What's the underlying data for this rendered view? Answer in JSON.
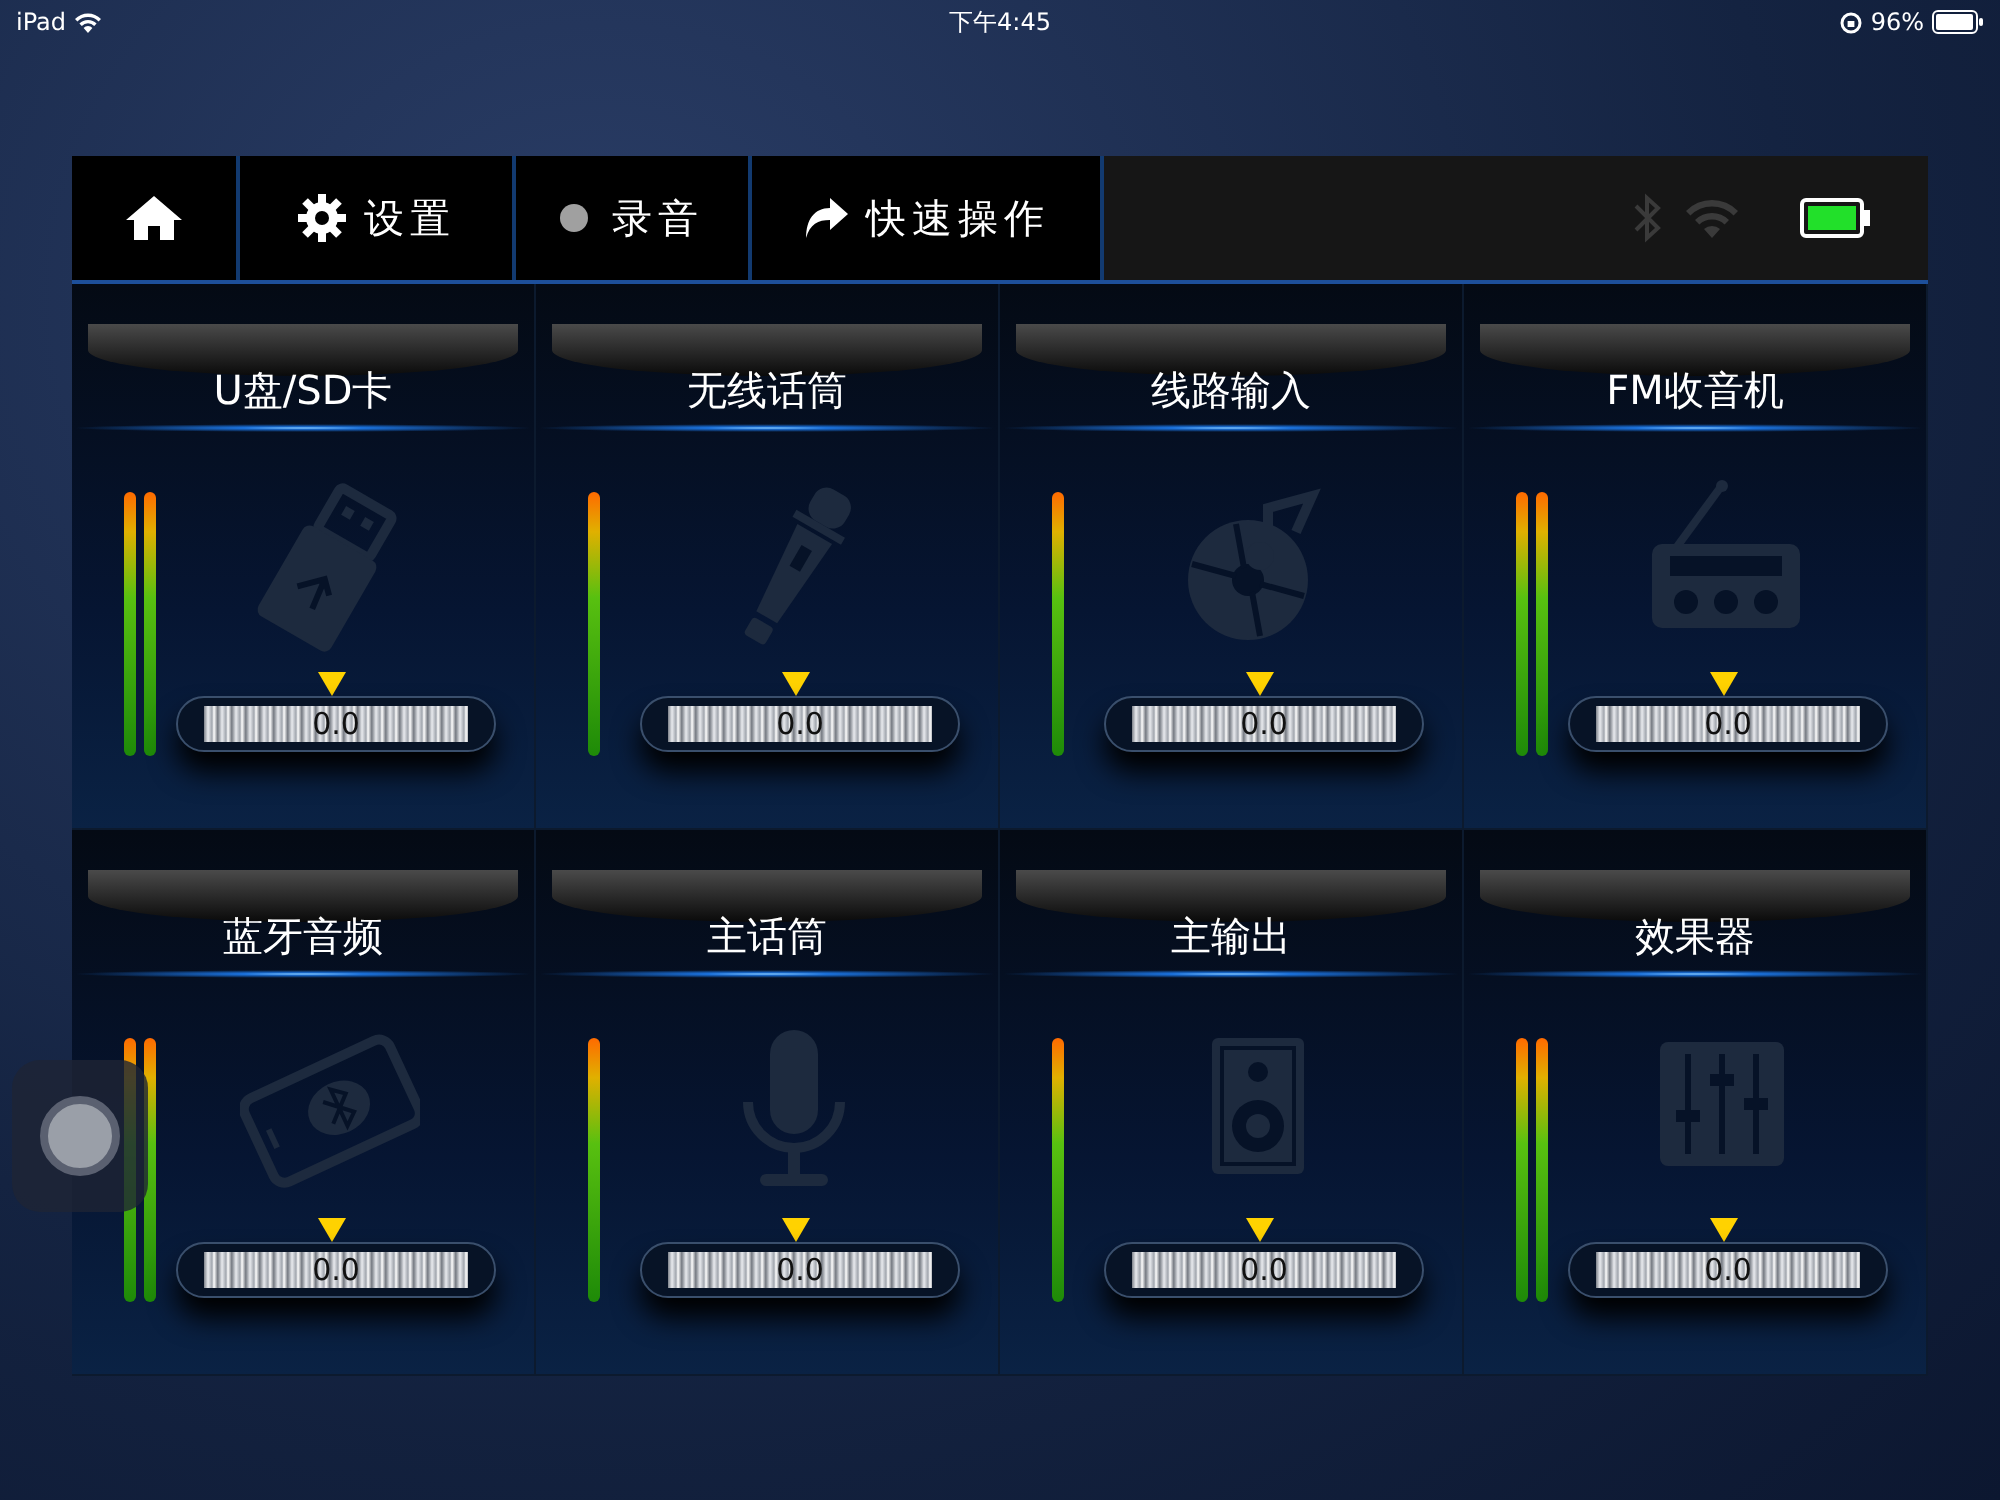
{
  "status_bar": {
    "device": "iPad",
    "time": "下午4:45",
    "battery": "96%"
  },
  "toolbar": {
    "settings": "设置",
    "record": {
      "label": "录音",
      "recording": false
    },
    "quick": "快速操作",
    "bluetooth_on": false,
    "wifi_on": false
  },
  "channels": [
    {
      "name": "U盘/SD卡",
      "kind": "usb",
      "stereo": true,
      "reading": "0.0"
    },
    {
      "name": "无线话筒",
      "kind": "wireless-mic",
      "stereo": false,
      "reading": "0.0"
    },
    {
      "name": "线路输入",
      "kind": "disc",
      "stereo": false,
      "reading": "0.0"
    },
    {
      "name": "FM收音机",
      "kind": "radio",
      "stereo": true,
      "reading": "0.0"
    },
    {
      "name": "蓝牙音频",
      "kind": "bluetooth-phone",
      "stereo": true,
      "reading": "0.0"
    },
    {
      "name": "主话筒",
      "kind": "mic",
      "stereo": false,
      "reading": "0.0"
    },
    {
      "name": "主输出",
      "kind": "speaker",
      "stereo": false,
      "reading": "0.0"
    },
    {
      "name": "效果器",
      "kind": "equalizer",
      "stereo": true,
      "reading": "0.0"
    }
  ]
}
